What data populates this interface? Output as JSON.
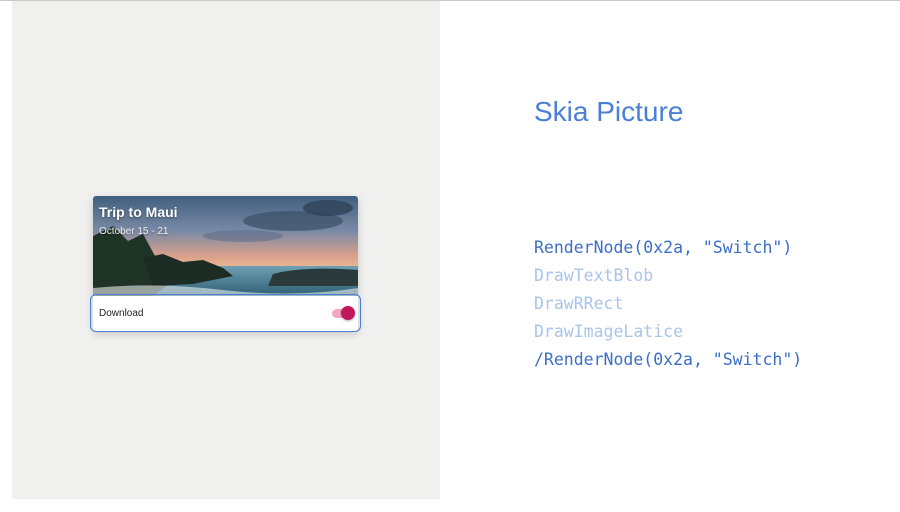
{
  "card": {
    "title": "Trip to Maui",
    "subtitle": "October 15 - 21",
    "download_label": "Download",
    "switch_on": true
  },
  "slide": {
    "heading": "Skia Picture",
    "code_lines": [
      "RenderNode(0x2a, \"Switch\")",
      "DrawTextBlob",
      "DrawRRect",
      "DrawImageLatice",
      "/RenderNode(0x2a, \"Switch\")"
    ]
  },
  "colors": {
    "accent": "#4a7fd6",
    "switch_thumb": "#c2185b",
    "switch_track": "#f2a8c3",
    "faint_code": "#a9c4ea"
  }
}
